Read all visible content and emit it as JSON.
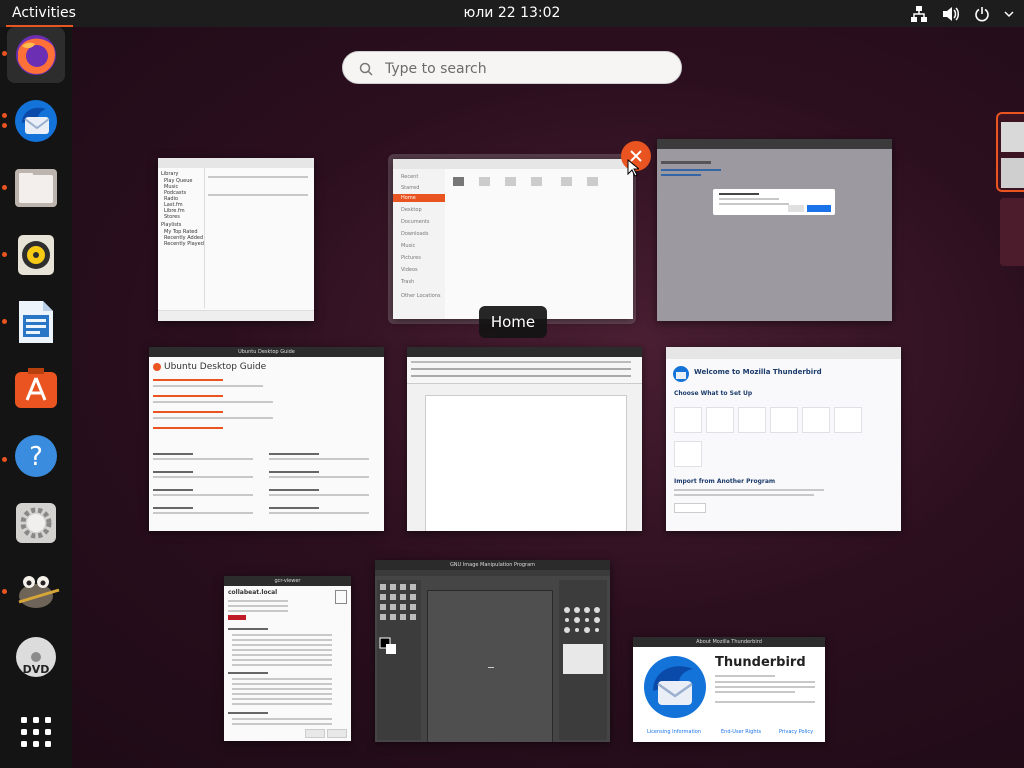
{
  "topbar": {
    "activities": "Activities",
    "clock": "юли 22  13:02",
    "tray_icons": [
      "network-icon",
      "volume-icon",
      "power-icon",
      "chevron-down-icon"
    ]
  },
  "dock": {
    "apps": [
      {
        "name": "Firefox",
        "icon": "firefox-icon",
        "running": true,
        "active": true
      },
      {
        "name": "Thunderbird",
        "icon": "thunderbird-icon",
        "running": true
      },
      {
        "name": "Files",
        "icon": "files-icon",
        "running": true
      },
      {
        "name": "Rhythmbox",
        "icon": "rhythmbox-icon",
        "running": true
      },
      {
        "name": "LibreOffice Writer",
        "icon": "writer-icon",
        "running": true
      },
      {
        "name": "Ubuntu Software",
        "icon": "software-icon",
        "running": false
      },
      {
        "name": "Help",
        "icon": "help-icon",
        "running": true
      },
      {
        "name": "Settings",
        "icon": "settings-icon",
        "running": false
      },
      {
        "name": "GIMP",
        "icon": "gimp-icon",
        "running": true
      },
      {
        "name": "DVD",
        "icon": "dvd-icon",
        "running": false
      },
      {
        "name": "Show Applications",
        "icon": "grid-icon",
        "running": false
      }
    ]
  },
  "search": {
    "placeholder": "Type to search"
  },
  "tooltip": "Home",
  "windows": {
    "rhythmbox": {
      "sidebar": [
        "Library",
        "Play Queue",
        "Music",
        "Podcasts",
        "Radio",
        "Last.fm",
        "Libre.fm",
        "Stores",
        "Playlists",
        "My Top Rated",
        "Recently Added",
        "Recently Played"
      ]
    },
    "files": {
      "sidebar": [
        "Recent",
        "Starred",
        "Home",
        "Desktop",
        "Documents",
        "Downloads",
        "Music",
        "Pictures",
        "Videos",
        "Trash",
        "Other Locations"
      ],
      "selected": "Home"
    },
    "help": {
      "title": "Ubuntu Desktop Guide"
    },
    "thunderbird_main": {
      "heading": "Welcome to Mozilla Thunderbird",
      "section1": "Choose What to Set Up",
      "section2": "Import from Another Program"
    },
    "gimp": {
      "title": "GNU Image Manipulation Program"
    },
    "about": {
      "window_title": "About Mozilla Thunderbird",
      "product": "Thunderbird",
      "links": [
        "Licensing Information",
        "End-User Rights",
        "Privacy Policy"
      ]
    },
    "cert": {
      "window_title": "gcr-viewer",
      "domain": "collabeat.local"
    }
  },
  "colors": {
    "accent": "#e95420",
    "topbar": "#1d1d1d",
    "dock": "#141414"
  }
}
